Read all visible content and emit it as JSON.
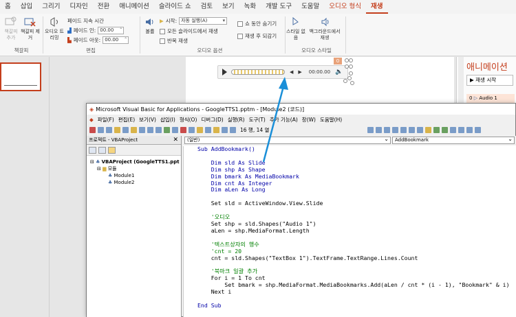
{
  "ribbon_tabs": [
    "홈",
    "삽입",
    "그리기",
    "디자인",
    "전환",
    "애니메이션",
    "슬라이드 쇼",
    "검토",
    "보기",
    "녹화",
    "개발 도구",
    "도움말",
    "오디오 형식",
    "재생"
  ],
  "ribbon": {
    "bookmark": {
      "add": "책갈피 추가",
      "remove": "책갈피 제거",
      "group": "책갈피"
    },
    "edit": {
      "trim": "오디오 트리밍",
      "fade_label": "페이드 지속 시간",
      "fade_in": "페이드 인:",
      "fade_out": "페이드 아웃:",
      "fade_in_value": "00.00",
      "fade_out_value": "00.00",
      "group": "편집"
    },
    "audio_options": {
      "volume": "볼륨",
      "start_label": "시작:",
      "start_value": "자동 실행(A)",
      "all_slides": "모든 슬라이드에서 재생",
      "loop": "반복 재생",
      "hide": "쇼 동안 숨기기",
      "rewind": "재생 후 되감기",
      "group": "오디오 옵션"
    },
    "audio_style": {
      "no_style": "스타일 없음",
      "background": "백그라운드에서 재생",
      "group": "오디오 스타일"
    }
  },
  "audio_player": {
    "time": "00:00.00",
    "volume_icon": "speaker-icon",
    "badge": "0"
  },
  "animation_pane": {
    "title": "애니메이션",
    "play_button": "재생 시작",
    "item_number": "0",
    "item_label": "Audio 1"
  },
  "vba": {
    "title": "Microsoft Visual Basic for Applications - GoogleTTS1.pptm - [Module2 (코드)]",
    "menu": [
      "파일(F)",
      "편집(E)",
      "보기(V)",
      "삽입(I)",
      "형식(O)",
      "디버그(D)",
      "실행(R)",
      "도구(T)",
      "추가 기능(A)",
      "창(W)",
      "도움말(H)"
    ],
    "position": "16 행, 14 열",
    "project_title": "프로젝트 - VBAProject",
    "project_name": "VBAProject (GoogleTTS1.ppt",
    "modules_folder": "모듈",
    "module1": "Module1",
    "module2": "Module2",
    "object_dropdown": "(일반)",
    "proc_dropdown": "AddBookmark"
  },
  "code_lines": [
    {
      "t": "Sub AddBookmark()",
      "c": "kw"
    },
    {
      "t": "",
      "c": ""
    },
    {
      "t": "    Dim sld As Slide",
      "c": "kw"
    },
    {
      "t": "    Dim shp As Shape",
      "c": "kw"
    },
    {
      "t": "    Dim bmark As MediaBookmark",
      "c": "kw"
    },
    {
      "t": "    Dim cnt As Integer",
      "c": "kw"
    },
    {
      "t": "    Dim aLen As Long",
      "c": "kw"
    },
    {
      "t": "",
      "c": ""
    },
    {
      "t": "    Set sld = ActiveWindow.View.Slide",
      "c": ""
    },
    {
      "t": "",
      "c": ""
    },
    {
      "t": "    '오디오",
      "c": "cm"
    },
    {
      "t": "    Set shp = sld.Shapes(\"Audio 1\")",
      "c": ""
    },
    {
      "t": "    aLen = shp.MediaFormat.Length",
      "c": ""
    },
    {
      "t": "",
      "c": ""
    },
    {
      "t": "    '텍스트상자의 행수",
      "c": "cm"
    },
    {
      "t": "    'cnt = 20",
      "c": "cm"
    },
    {
      "t": "    cnt = sld.Shapes(\"TextBox 1\").TextFrame.TextRange.Lines.Count",
      "c": ""
    },
    {
      "t": "",
      "c": ""
    },
    {
      "t": "    '북마크 일괄 추가",
      "c": "cm"
    },
    {
      "t": "    For i = 1 To cnt",
      "c": ""
    },
    {
      "t": "        Set bmark = shp.MediaFormat.MediaBookmarks.Add(aLen / cnt * (i - 1), \"Bookmark\" & i)",
      "c": ""
    },
    {
      "t": "    Next i",
      "c": ""
    },
    {
      "t": "",
      "c": ""
    },
    {
      "t": "End Sub",
      "c": "kw"
    }
  ]
}
